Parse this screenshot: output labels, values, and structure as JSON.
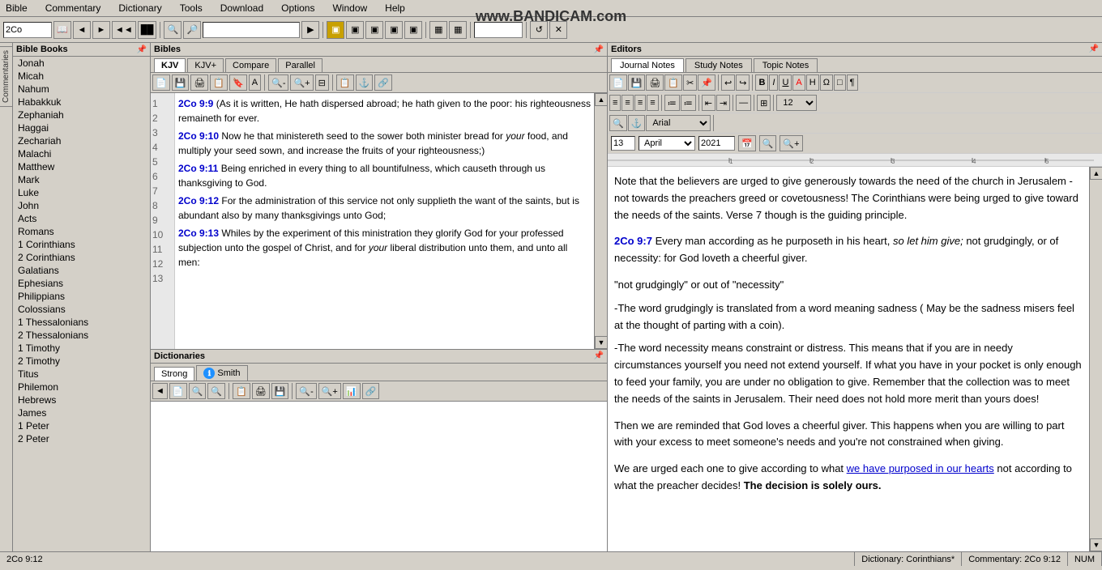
{
  "watermark": "www.BANDICAM.com",
  "menubar": {
    "items": [
      "Bible",
      "Commentary",
      "Dictionary",
      "Tools",
      "Download",
      "Options",
      "Window",
      "Help"
    ]
  },
  "toolbar": {
    "book_input": "2Co",
    "nav_btns": [
      "◄",
      "►",
      "◄◄",
      "►►"
    ],
    "search_placeholder": "",
    "chapter_input": ""
  },
  "bible_books": {
    "title": "Bible Books",
    "books": [
      "Jonah",
      "Micah",
      "Nahum",
      "Habakkuk",
      "Zephaniah",
      "Haggai",
      "Zechariah",
      "Malachi",
      "Matthew",
      "Mark",
      "Luke",
      "John",
      "Acts",
      "Romans",
      "1 Corinthians",
      "2 Corinthians",
      "Galatians",
      "Ephesians",
      "Philippians",
      "Colossians",
      "1 Thessalonians",
      "2 Thessalonians",
      "1 Timothy",
      "2 Timothy",
      "Titus",
      "Philemon",
      "Hebrews",
      "James",
      "1 Peter",
      "2 Peter"
    ],
    "line_numbers": [
      1,
      2,
      3,
      4,
      5,
      6,
      7,
      8,
      9,
      10,
      11,
      12,
      13
    ]
  },
  "bibles": {
    "title": "Bibles",
    "tabs": [
      "KJV",
      "KJV+",
      "Compare",
      "Parallel"
    ],
    "active_tab": "KJV",
    "verses": [
      {
        "ref": "2Co 9:9",
        "text": " (As it is written, He hath dispersed abroad; he hath given to the poor: his righteousness remaineth for ever."
      },
      {
        "ref": "2Co 9:10",
        "text": " Now he that ministereth seed to the sower both minister bread for ",
        "italic": "your",
        "text2": " food, and multiply your seed sown, and increase the fruits of your righteousness;)"
      },
      {
        "ref": "2Co 9:11",
        "text": " Being enriched in every thing to all bountifulness, which causeth through us thanksgiving to God."
      },
      {
        "ref": "2Co 9:12",
        "text": " For the administration of this service not only supplieth the want of the saints, but is abundant also by many thanksgivings unto God;"
      },
      {
        "ref": "2Co 9:13",
        "text": " Whiles by the experiment of this ministration they glorify God for your professed subjection unto the gospel of Christ, and for ",
        "italic": "your",
        "text2": " liberal distribution unto them, and unto all men:"
      }
    ],
    "line_numbers": [
      1,
      2,
      3,
      4,
      5,
      6,
      7,
      8,
      9,
      10,
      11,
      12,
      13
    ]
  },
  "dictionaries": {
    "title": "Dictionaries",
    "tabs": [
      "Strong",
      "Smith"
    ],
    "active_tab": "Strong",
    "smith_icon": "ℹ"
  },
  "editors": {
    "title": "Editors",
    "tabs": [
      "Journal Notes",
      "Study Notes",
      "Topic Notes"
    ],
    "active_tab": "Journal Notes",
    "date": {
      "day": "13",
      "month": "April",
      "year": "2021"
    },
    "content": [
      {
        "type": "paragraph",
        "text": "Note that the believers are urged to give generously towards the need of the church in Jerusalem - not towards the preachers greed or covetousness! The Corinthians were being urged to give toward the needs of the saints. Verse 7 though is the guiding principle."
      },
      {
        "type": "verse_quote",
        "ref": "2Co 9:7",
        "text": " Every man according as he purposeth in his heart, ",
        "italic": "so let him give;",
        "text2": " not grudgingly, or of necessity: for God loveth a cheerful giver."
      },
      {
        "type": "paragraph",
        "text": "\"not grudgingly\" or out of \"necessity\""
      },
      {
        "type": "paragraph",
        "text": "-The word grudgingly is translated from a word meaning sadness ( May be the sadness misers feel at the thought of parting with a coin)."
      },
      {
        "type": "paragraph",
        "text": "-The word necessity means constraint or distress. This means that if you are in needy circumstances yourself you need not extend yourself. If what you have in your pocket is only enough to feed your family, you are under no obligation to give. Remember that the collection was to meet the needs of the saints in Jerusalem. Their need does not hold more merit than yours does!"
      },
      {
        "type": "paragraph",
        "text": "Then we are reminded that God loves a cheerful giver. This happens when you are willing to part with your excess to meet someone's needs and you're not constrained when giving."
      },
      {
        "type": "paragraph",
        "text": "We are urged each one to give according to what ",
        "link": "we have purposed in our hearts",
        "text2": " not according to what the preacher decides! ",
        "bold": "The decision is solely ours."
      }
    ]
  },
  "statusbar": {
    "ref": "2Co 9:12",
    "dictionary": "Dictionary: Corinthians*",
    "commentary": "Commentary: 2Co 9:12",
    "num": "NUM"
  }
}
